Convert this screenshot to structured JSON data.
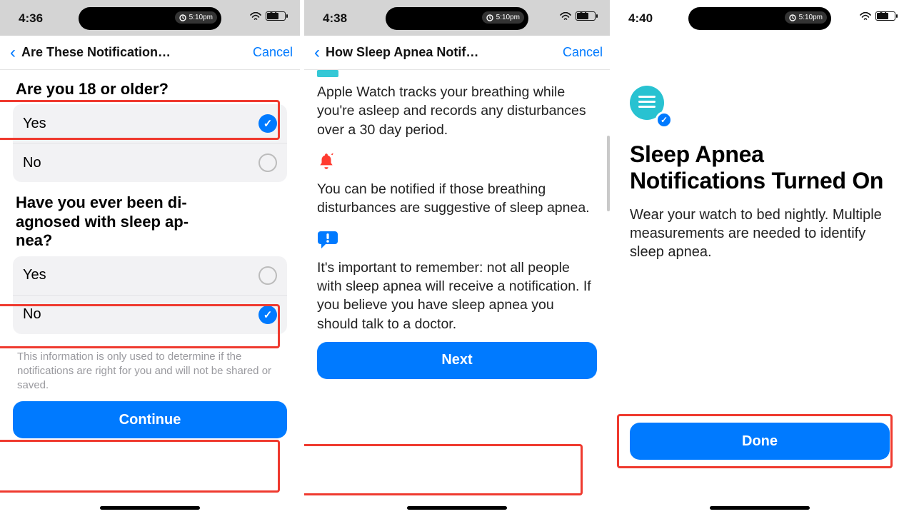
{
  "screen1": {
    "time": "4:36",
    "pill_time": "5:10pm",
    "battery": "64",
    "nav_title": "Are These Notification…",
    "cancel": "Cancel",
    "q1": "Are you 18 or older?",
    "q1_yes": "Yes",
    "q1_no": "No",
    "q2": "Have you ever been di-\nagnosed with sleep ap-\nnea?",
    "q2_yes": "Yes",
    "q2_no": "No",
    "disclaimer": "This information is only used to determine if the notifications are right for you and will not be shared or saved.",
    "continue": "Continue"
  },
  "screen2": {
    "time": "4:38",
    "pill_time": "5:10pm",
    "battery": "64",
    "nav_title": "How Sleep Apnea Notif…",
    "cancel": "Cancel",
    "p1": "Apple Watch tracks your breathing while you're asleep and records any disturbances over a 30 day period.",
    "p2": "You can be notified if those breathing disturbances are suggestive of sleep apnea.",
    "p3": "It's important to remember: not all people with sleep apnea will receive a notification. If you believe you have sleep apnea you should talk to a doctor.",
    "next": "Next"
  },
  "screen3": {
    "time": "4:40",
    "pill_time": "5:10pm",
    "battery": "64",
    "title": "Sleep Apnea Notifications Turned On",
    "body": "Wear your watch to bed nightly. Multiple measurements are needed to identify sleep apnea.",
    "done": "Done"
  }
}
